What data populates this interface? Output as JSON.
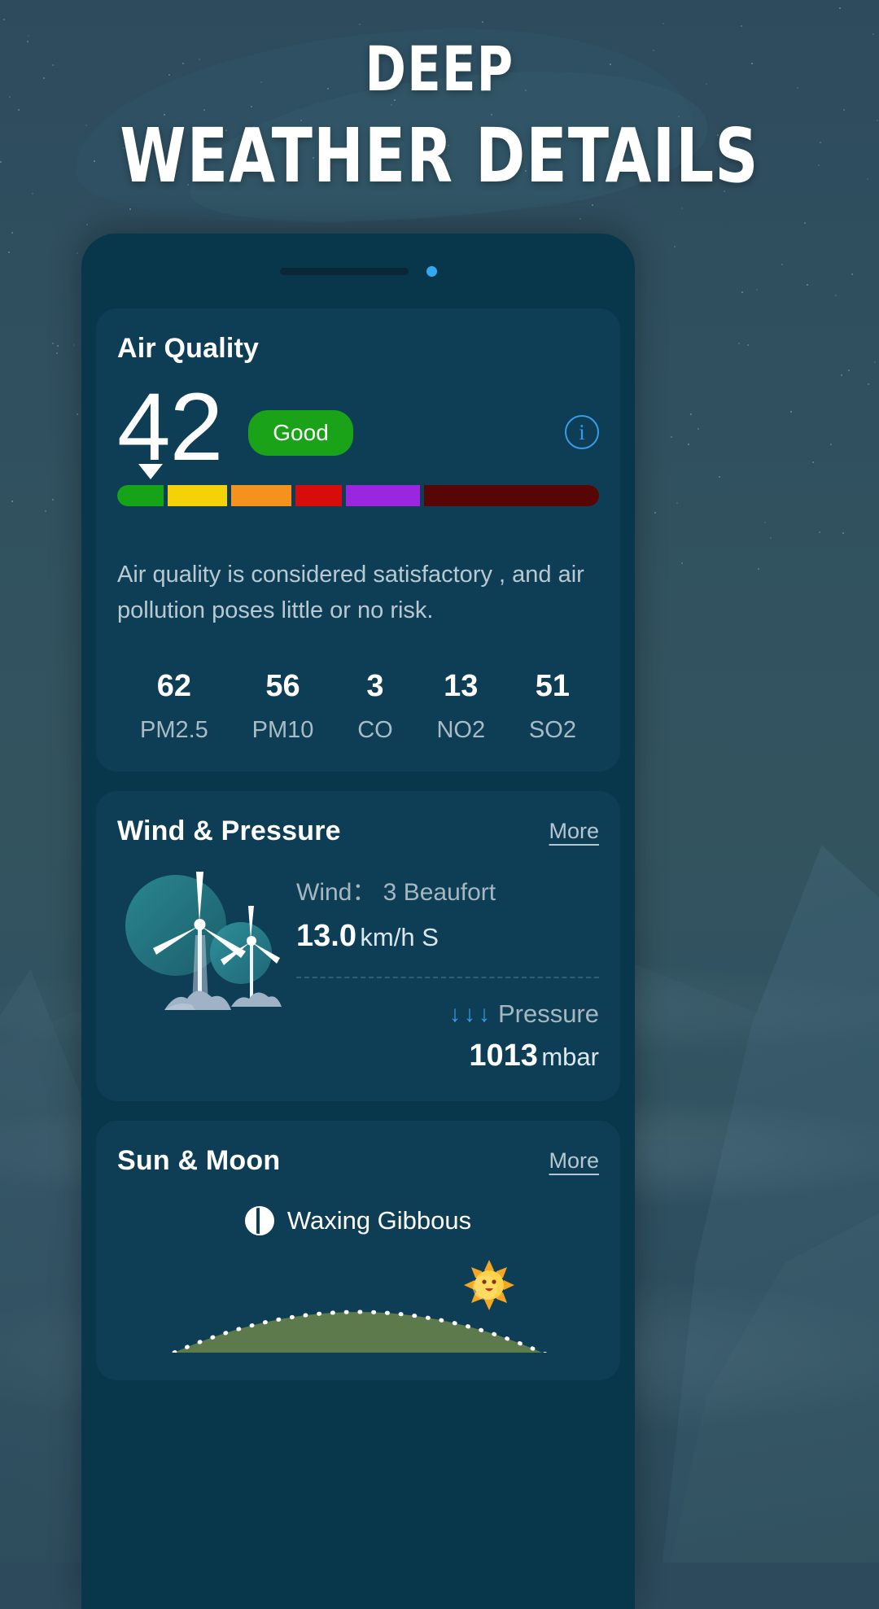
{
  "header": {
    "title_line1": "DEEP",
    "title_line2": "WEATHER DETAILS"
  },
  "phone": {
    "speaker_icon": "speaker-slot",
    "camera_icon": "camera-dot"
  },
  "air_quality": {
    "title": "Air Quality",
    "aqi_value": "42",
    "badge": "Good",
    "info_icon": "info-icon",
    "info_glyph": "i",
    "pointer_percent": 7,
    "description": "Air quality is considered satisfactory , and air pollution poses little or no risk.",
    "scale": [
      {
        "name": "good",
        "color": "#17a317",
        "width": 10
      },
      {
        "name": "moderate",
        "color": "#f5d208",
        "width": 13
      },
      {
        "name": "unhealthy-sensitive",
        "color": "#f5921e",
        "width": 13
      },
      {
        "name": "unhealthy",
        "color": "#d90c0c",
        "width": 10
      },
      {
        "name": "very-unhealthy",
        "color": "#9b26e0",
        "width": 16
      },
      {
        "name": "hazardous",
        "color": "#580505",
        "width": 38
      }
    ],
    "pollutants": [
      {
        "value": "62",
        "label": "PM2.5"
      },
      {
        "value": "56",
        "label": "PM10"
      },
      {
        "value": "3",
        "label": "CO"
      },
      {
        "value": "13",
        "label": "NO2"
      },
      {
        "value": "51",
        "label": "SO2"
      }
    ]
  },
  "wind_pressure": {
    "title": "Wind & Pressure",
    "more": "More",
    "wind_label": "Wind：  3 Beaufort",
    "wind_value": "13.0",
    "wind_unit": "km/h S",
    "pressure_arrows": "↓↓↓",
    "pressure_label": "Pressure",
    "pressure_value": "1013",
    "pressure_unit": "mbar",
    "illustration": "wind-turbines"
  },
  "sun_moon": {
    "title": "Sun & Moon",
    "more": "More",
    "moon_phase": "Waxing Gibbous",
    "moon_icon": "moon-waxing-gibbous-icon",
    "sun_icon": "sun-emoji"
  },
  "colors": {
    "page_bg": "#2c4a5b",
    "phone_body": "#08374b",
    "card_bg": "#0e3e55",
    "accent_blue": "#3b9ae8",
    "good_green": "#1aa318",
    "sun_arc_green": "#5d7a4d"
  }
}
